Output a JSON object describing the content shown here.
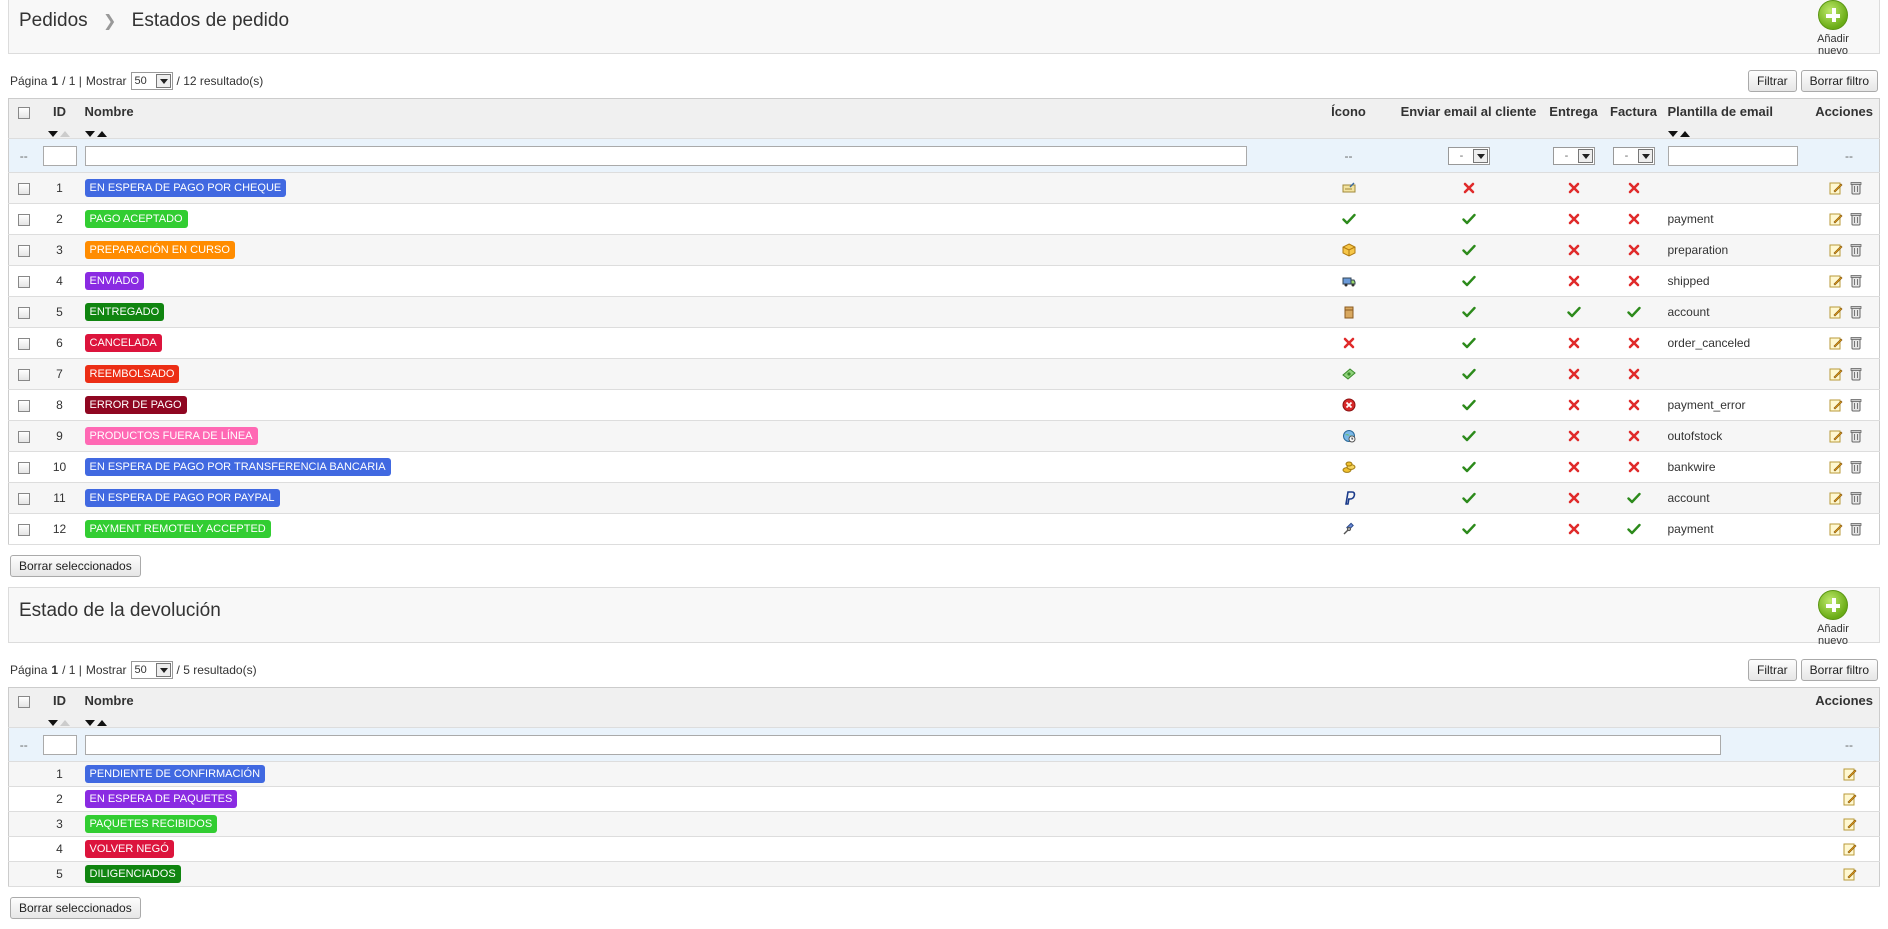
{
  "colors": {
    "check": "#2c8a1b",
    "cross": "#e02a2a"
  },
  "section1": {
    "breadcrumb_parent": "Pedidos",
    "breadcrumb_current": "Estados de pedido",
    "add_new": "Añadir nuevo",
    "pager": {
      "page_label": "Página",
      "page": "1",
      "of": "/ 1 |",
      "show_label": "Mostrar",
      "per_page": "50",
      "results": "/ 12 resultado(s)"
    },
    "filter_btn": "Filtrar",
    "reset_btn": "Borrar filtro",
    "delete_selected": "Borrar seleccionados",
    "columns": {
      "id": "ID",
      "name": "Nombre",
      "icon": "Ícono",
      "send_email": "Enviar email al cliente",
      "delivery": "Entrega",
      "invoice": "Factura",
      "template": "Plantilla de email",
      "actions": "Acciones"
    },
    "filter_placeholders": {
      "dash": "--",
      "select": "-"
    },
    "rows": [
      {
        "id": "1",
        "name": "EN ESPERA DE PAGO POR CHEQUE",
        "color": "#4169e1",
        "icon": "cheque-icon",
        "email": false,
        "delivery": false,
        "invoice": false,
        "template": ""
      },
      {
        "id": "2",
        "name": "PAGO ACEPTADO",
        "color": "#32cd32",
        "icon": "check-icon",
        "email": true,
        "delivery": false,
        "invoice": false,
        "template": "payment"
      },
      {
        "id": "3",
        "name": "PREPARACIÓN EN CURSO",
        "color": "#ff8c00",
        "icon": "package-icon",
        "email": true,
        "delivery": false,
        "invoice": false,
        "template": "preparation"
      },
      {
        "id": "4",
        "name": "ENVIADO",
        "color": "#8a2be2",
        "icon": "truck-icon",
        "email": true,
        "delivery": false,
        "invoice": false,
        "template": "shipped"
      },
      {
        "id": "5",
        "name": "ENTREGADO",
        "color": "#108510",
        "icon": "box-icon",
        "email": true,
        "delivery": true,
        "invoice": true,
        "template": "account"
      },
      {
        "id": "6",
        "name": "CANCELADA",
        "color": "#dc143c",
        "icon": "cross-icon",
        "email": true,
        "delivery": false,
        "invoice": false,
        "template": "order_canceled"
      },
      {
        "id": "7",
        "name": "REEMBOLSADO",
        "color": "#ec2e15",
        "icon": "money-icon",
        "email": true,
        "delivery": false,
        "invoice": false,
        "template": ""
      },
      {
        "id": "8",
        "name": "ERROR DE PAGO",
        "color": "#8f0621",
        "icon": "error-icon",
        "email": true,
        "delivery": false,
        "invoice": false,
        "template": "payment_error"
      },
      {
        "id": "9",
        "name": "PRODUCTOS FUERA DE LÍNEA",
        "color": "#ff69b4",
        "icon": "globe-clock-icon",
        "email": true,
        "delivery": false,
        "invoice": false,
        "template": "outofstock"
      },
      {
        "id": "10",
        "name": "EN ESPERA DE PAGO POR TRANSFERENCIA BANCARIA",
        "color": "#4169e1",
        "icon": "coins-icon",
        "email": true,
        "delivery": false,
        "invoice": false,
        "template": "bankwire"
      },
      {
        "id": "11",
        "name": "EN ESPERA DE PAGO POR PAYPAL",
        "color": "#4169e1",
        "icon": "paypal-icon",
        "email": true,
        "delivery": false,
        "invoice": true,
        "template": "account"
      },
      {
        "id": "12",
        "name": "PAYMENT REMOTELY ACCEPTED",
        "color": "#32cd32",
        "icon": "satellite-icon",
        "email": true,
        "delivery": false,
        "invoice": true,
        "template": "payment"
      }
    ]
  },
  "section2": {
    "title": "Estado de la devolución",
    "add_new": "Añadir nuevo",
    "pager": {
      "page_label": "Página",
      "page": "1",
      "of": "/ 1 |",
      "show_label": "Mostrar",
      "per_page": "50",
      "results": "/ 5 resultado(s)"
    },
    "filter_btn": "Filtrar",
    "reset_btn": "Borrar filtro",
    "delete_selected": "Borrar seleccionados",
    "columns": {
      "id": "ID",
      "name": "Nombre",
      "actions": "Acciones"
    },
    "filter_placeholders": {
      "dash": "--"
    },
    "rows": [
      {
        "id": "1",
        "name": "PENDIENTE DE CONFIRMACIÓN",
        "color": "#4169e1"
      },
      {
        "id": "2",
        "name": "EN ESPERA DE PAQUETES",
        "color": "#8a2be2"
      },
      {
        "id": "3",
        "name": "PAQUETES RECIBIDOS",
        "color": "#32cd32"
      },
      {
        "id": "4",
        "name": "VOLVER NEGÓ",
        "color": "#dc143c"
      },
      {
        "id": "5",
        "name": "DILIGENCIADOS",
        "color": "#108510"
      }
    ]
  }
}
